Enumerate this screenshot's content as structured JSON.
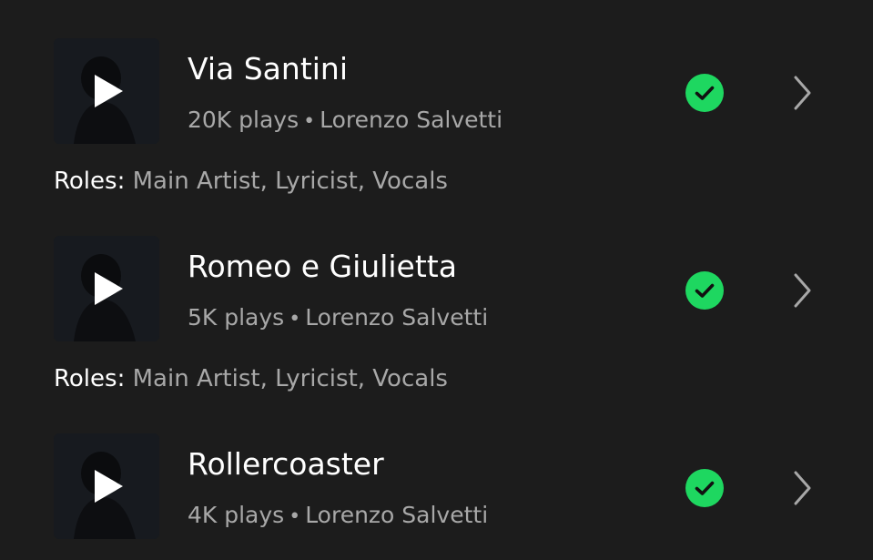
{
  "tracks": [
    {
      "title": "Via Santini",
      "plays": "20K plays",
      "separator": "•",
      "artist": "Lorenzo Salvetti",
      "roles_label": "Roles:",
      "roles_value": "Main Artist, Lyricist, Vocals"
    },
    {
      "title": "Romeo e Giulietta",
      "plays": "5K plays",
      "separator": "•",
      "artist": "Lorenzo Salvetti",
      "roles_label": "Roles:",
      "roles_value": "Main Artist, Lyricist, Vocals"
    },
    {
      "title": "Rollercoaster",
      "plays": "4K plays",
      "separator": "•",
      "artist": "Lorenzo Salvetti"
    }
  ],
  "icons": {
    "play": "play-icon",
    "verified": "check-circle-icon",
    "chevron": "chevron-right-icon"
  },
  "colors": {
    "background": "#1c1c1c",
    "accent_green": "#1ed760",
    "text_primary": "#ffffff",
    "text_secondary": "#a8a8a8"
  }
}
